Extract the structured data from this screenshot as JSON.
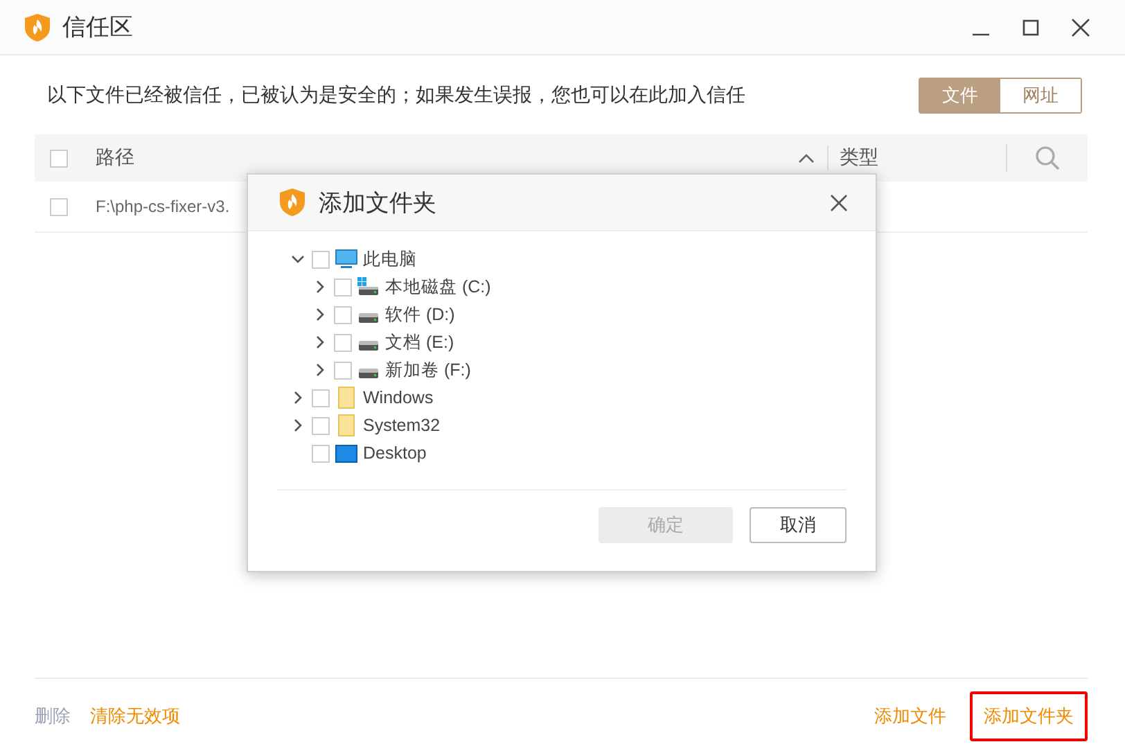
{
  "window": {
    "title": "信任区"
  },
  "notice": "以下文件已经被信任，已被认为是安全的；如果发生误报，您也可以在此加入信任",
  "tabs": [
    {
      "label": "文件",
      "selected": true
    },
    {
      "label": "网址",
      "selected": false
    }
  ],
  "table": {
    "header_checked": false,
    "columns": [
      "路径",
      "类型"
    ],
    "rows": [
      {
        "checked": false,
        "path": "F:\\php-cs-fixer-v3."
      }
    ]
  },
  "footer": {
    "left": [
      {
        "label": "删除",
        "disabled": true
      },
      {
        "label": "清除无效项",
        "disabled": false
      }
    ],
    "right": [
      {
        "label": "添加文件",
        "highlighted": false
      },
      {
        "label": "添加文件夹",
        "highlighted": true
      }
    ]
  },
  "dialog": {
    "title": "添加文件夹",
    "tree": [
      {
        "label": "此电脑",
        "kind": "computer",
        "expanded": true,
        "checked": false,
        "children": [
          {
            "label": "本地磁盘 (C:)",
            "kind": "system-drive",
            "expanded": false,
            "checked": false,
            "has_children": true
          },
          {
            "label": "软件 (D:)",
            "kind": "drive",
            "expanded": false,
            "checked": false,
            "has_children": true
          },
          {
            "label": "文档 (E:)",
            "kind": "drive",
            "expanded": false,
            "checked": false,
            "has_children": true
          },
          {
            "label": "新加卷 (F:)",
            "kind": "drive",
            "expanded": false,
            "checked": false,
            "has_children": true
          }
        ]
      },
      {
        "label": "Windows",
        "kind": "folder",
        "expanded": false,
        "checked": false,
        "has_children": true
      },
      {
        "label": "System32",
        "kind": "folder",
        "expanded": false,
        "checked": false,
        "has_children": true
      },
      {
        "label": "Desktop",
        "kind": "desktop",
        "checked": false,
        "has_children": false
      }
    ],
    "buttons": [
      {
        "label": "确定",
        "disabled": true
      },
      {
        "label": "取消",
        "disabled": false
      }
    ]
  }
}
